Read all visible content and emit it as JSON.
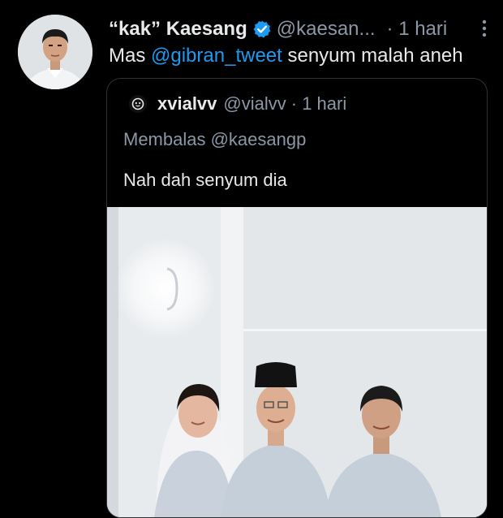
{
  "tweet": {
    "author_name": "“kak” Kaesang",
    "author_handle": "@kaesan...",
    "time": "· 1 hari",
    "text_prefix": "Mas ",
    "mention": "@gibran_tweet",
    "text_suffix": " senyum malah aneh"
  },
  "quoted": {
    "author_name": "xvialvv",
    "author_handle": "@vialvv",
    "time": "· 1 hari",
    "reply_to": "Membalas @kaesangp",
    "text": "Nah dah senyum dia"
  },
  "colors": {
    "background": "#000000",
    "text": "#e7e9ea",
    "secondary": "#8b98a5",
    "link": "#1d9bf0",
    "verified_badge": "#1d9bf0",
    "border": "#2f3336"
  },
  "icons": {
    "verified": "verified-badge-icon",
    "more": "more-vertical-icon"
  }
}
